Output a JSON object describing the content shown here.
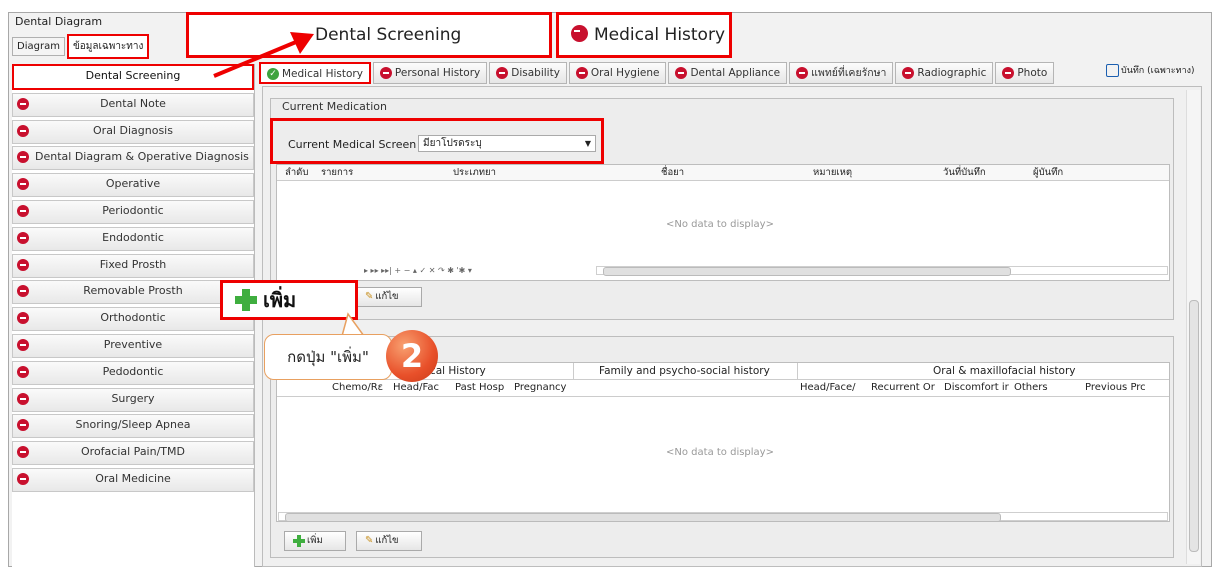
{
  "window": {
    "title": "Dental Diagram"
  },
  "left_tabs": [
    "Diagram",
    "ข้อมูลเฉพาะทาง"
  ],
  "sidebar": {
    "items": [
      {
        "label": "Dental Screening",
        "active": true
      },
      {
        "label": "Dental Note"
      },
      {
        "label": "Oral Diagnosis"
      },
      {
        "label": "Dental Diagram & Operative Diagnosis"
      },
      {
        "label": "Operative"
      },
      {
        "label": "Periodontic"
      },
      {
        "label": "Endodontic"
      },
      {
        "label": "Fixed Prosth"
      },
      {
        "label": "Removable Prosth"
      },
      {
        "label": "Orthodontic"
      },
      {
        "label": "Preventive"
      },
      {
        "label": "Pedodontic"
      },
      {
        "label": "Surgery"
      },
      {
        "label": "Snoring/Sleep Apnea"
      },
      {
        "label": "Orofacial Pain/TMD"
      },
      {
        "label": "Oral Medicine"
      }
    ]
  },
  "callout_top": {
    "left": "Dental Screening",
    "right": "Medical History"
  },
  "top_tabs": [
    "Medical History",
    "Personal History",
    "Disability",
    "Oral Hygiene",
    "Dental Appliance",
    "แพทย์ที่เคยรักษา",
    "Radiographic",
    "Photo"
  ],
  "save_button": "บันทึก (เฉพาะทาง)",
  "current_medication": {
    "group_title": "Current Medication",
    "screen_label": "Current Medical Screen",
    "screen_value": "มียาโปรดระบุ",
    "columns": [
      "ลำดับ",
      "รายการ",
      "ประเภทยา",
      "ชื่อยา",
      "หมายเหตุ",
      "วันที่บันทึก",
      "ผู้บันทึก"
    ],
    "no_data": "<No data to display>",
    "nav_symbols": "▸ ▸▸ ▸▸| + − ▴ ✓ ✕ ↷ ✱ '✱ ▾",
    "edit_button": "แก้ไข"
  },
  "history_grid": {
    "bands": [
      "ical History",
      "Family and psycho-social history",
      "Oral & maxillofacial history"
    ],
    "columns": [
      "Chemo/Rε",
      "Head/Fac",
      "Past Hosp",
      "Pregnancy",
      "Head/Face/",
      "Recurrent Or",
      "Discomfort ir",
      "Others",
      "Previous Prc"
    ],
    "no_data": "<No data to display>",
    "add_button": "เพิ่ม",
    "edit_button": "แก้ไข"
  },
  "annotation": {
    "add_callout": "เพิ่ม",
    "instruction": "กดปุ่ม \"เพิ่ม\"",
    "step": "2"
  },
  "colors": {
    "highlight": "#ee0000",
    "red_icon": "#c8102e",
    "green_icon": "#3ea33e",
    "step_badge": "#e8502a"
  }
}
